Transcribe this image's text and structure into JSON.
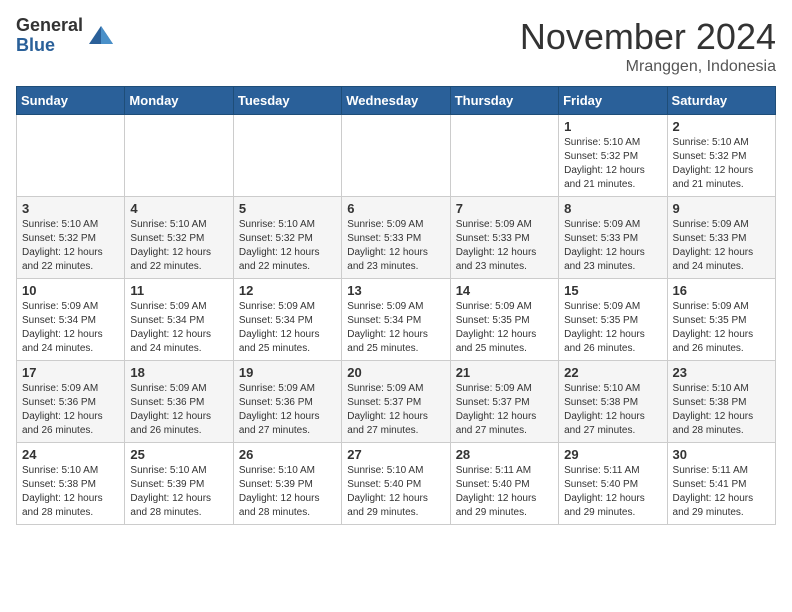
{
  "header": {
    "logo_general": "General",
    "logo_blue": "Blue",
    "month_title": "November 2024",
    "location": "Mranggen, Indonesia"
  },
  "days_of_week": [
    "Sunday",
    "Monday",
    "Tuesday",
    "Wednesday",
    "Thursday",
    "Friday",
    "Saturday"
  ],
  "weeks": [
    [
      {
        "day": "",
        "info": ""
      },
      {
        "day": "",
        "info": ""
      },
      {
        "day": "",
        "info": ""
      },
      {
        "day": "",
        "info": ""
      },
      {
        "day": "",
        "info": ""
      },
      {
        "day": "1",
        "info": "Sunrise: 5:10 AM\nSunset: 5:32 PM\nDaylight: 12 hours\nand 21 minutes."
      },
      {
        "day": "2",
        "info": "Sunrise: 5:10 AM\nSunset: 5:32 PM\nDaylight: 12 hours\nand 21 minutes."
      }
    ],
    [
      {
        "day": "3",
        "info": "Sunrise: 5:10 AM\nSunset: 5:32 PM\nDaylight: 12 hours\nand 22 minutes."
      },
      {
        "day": "4",
        "info": "Sunrise: 5:10 AM\nSunset: 5:32 PM\nDaylight: 12 hours\nand 22 minutes."
      },
      {
        "day": "5",
        "info": "Sunrise: 5:10 AM\nSunset: 5:32 PM\nDaylight: 12 hours\nand 22 minutes."
      },
      {
        "day": "6",
        "info": "Sunrise: 5:09 AM\nSunset: 5:33 PM\nDaylight: 12 hours\nand 23 minutes."
      },
      {
        "day": "7",
        "info": "Sunrise: 5:09 AM\nSunset: 5:33 PM\nDaylight: 12 hours\nand 23 minutes."
      },
      {
        "day": "8",
        "info": "Sunrise: 5:09 AM\nSunset: 5:33 PM\nDaylight: 12 hours\nand 23 minutes."
      },
      {
        "day": "9",
        "info": "Sunrise: 5:09 AM\nSunset: 5:33 PM\nDaylight: 12 hours\nand 24 minutes."
      }
    ],
    [
      {
        "day": "10",
        "info": "Sunrise: 5:09 AM\nSunset: 5:34 PM\nDaylight: 12 hours\nand 24 minutes."
      },
      {
        "day": "11",
        "info": "Sunrise: 5:09 AM\nSunset: 5:34 PM\nDaylight: 12 hours\nand 24 minutes."
      },
      {
        "day": "12",
        "info": "Sunrise: 5:09 AM\nSunset: 5:34 PM\nDaylight: 12 hours\nand 25 minutes."
      },
      {
        "day": "13",
        "info": "Sunrise: 5:09 AM\nSunset: 5:34 PM\nDaylight: 12 hours\nand 25 minutes."
      },
      {
        "day": "14",
        "info": "Sunrise: 5:09 AM\nSunset: 5:35 PM\nDaylight: 12 hours\nand 25 minutes."
      },
      {
        "day": "15",
        "info": "Sunrise: 5:09 AM\nSunset: 5:35 PM\nDaylight: 12 hours\nand 26 minutes."
      },
      {
        "day": "16",
        "info": "Sunrise: 5:09 AM\nSunset: 5:35 PM\nDaylight: 12 hours\nand 26 minutes."
      }
    ],
    [
      {
        "day": "17",
        "info": "Sunrise: 5:09 AM\nSunset: 5:36 PM\nDaylight: 12 hours\nand 26 minutes."
      },
      {
        "day": "18",
        "info": "Sunrise: 5:09 AM\nSunset: 5:36 PM\nDaylight: 12 hours\nand 26 minutes."
      },
      {
        "day": "19",
        "info": "Sunrise: 5:09 AM\nSunset: 5:36 PM\nDaylight: 12 hours\nand 27 minutes."
      },
      {
        "day": "20",
        "info": "Sunrise: 5:09 AM\nSunset: 5:37 PM\nDaylight: 12 hours\nand 27 minutes."
      },
      {
        "day": "21",
        "info": "Sunrise: 5:09 AM\nSunset: 5:37 PM\nDaylight: 12 hours\nand 27 minutes."
      },
      {
        "day": "22",
        "info": "Sunrise: 5:10 AM\nSunset: 5:38 PM\nDaylight: 12 hours\nand 27 minutes."
      },
      {
        "day": "23",
        "info": "Sunrise: 5:10 AM\nSunset: 5:38 PM\nDaylight: 12 hours\nand 28 minutes."
      }
    ],
    [
      {
        "day": "24",
        "info": "Sunrise: 5:10 AM\nSunset: 5:38 PM\nDaylight: 12 hours\nand 28 minutes."
      },
      {
        "day": "25",
        "info": "Sunrise: 5:10 AM\nSunset: 5:39 PM\nDaylight: 12 hours\nand 28 minutes."
      },
      {
        "day": "26",
        "info": "Sunrise: 5:10 AM\nSunset: 5:39 PM\nDaylight: 12 hours\nand 28 minutes."
      },
      {
        "day": "27",
        "info": "Sunrise: 5:10 AM\nSunset: 5:40 PM\nDaylight: 12 hours\nand 29 minutes."
      },
      {
        "day": "28",
        "info": "Sunrise: 5:11 AM\nSunset: 5:40 PM\nDaylight: 12 hours\nand 29 minutes."
      },
      {
        "day": "29",
        "info": "Sunrise: 5:11 AM\nSunset: 5:40 PM\nDaylight: 12 hours\nand 29 minutes."
      },
      {
        "day": "30",
        "info": "Sunrise: 5:11 AM\nSunset: 5:41 PM\nDaylight: 12 hours\nand 29 minutes."
      }
    ]
  ]
}
